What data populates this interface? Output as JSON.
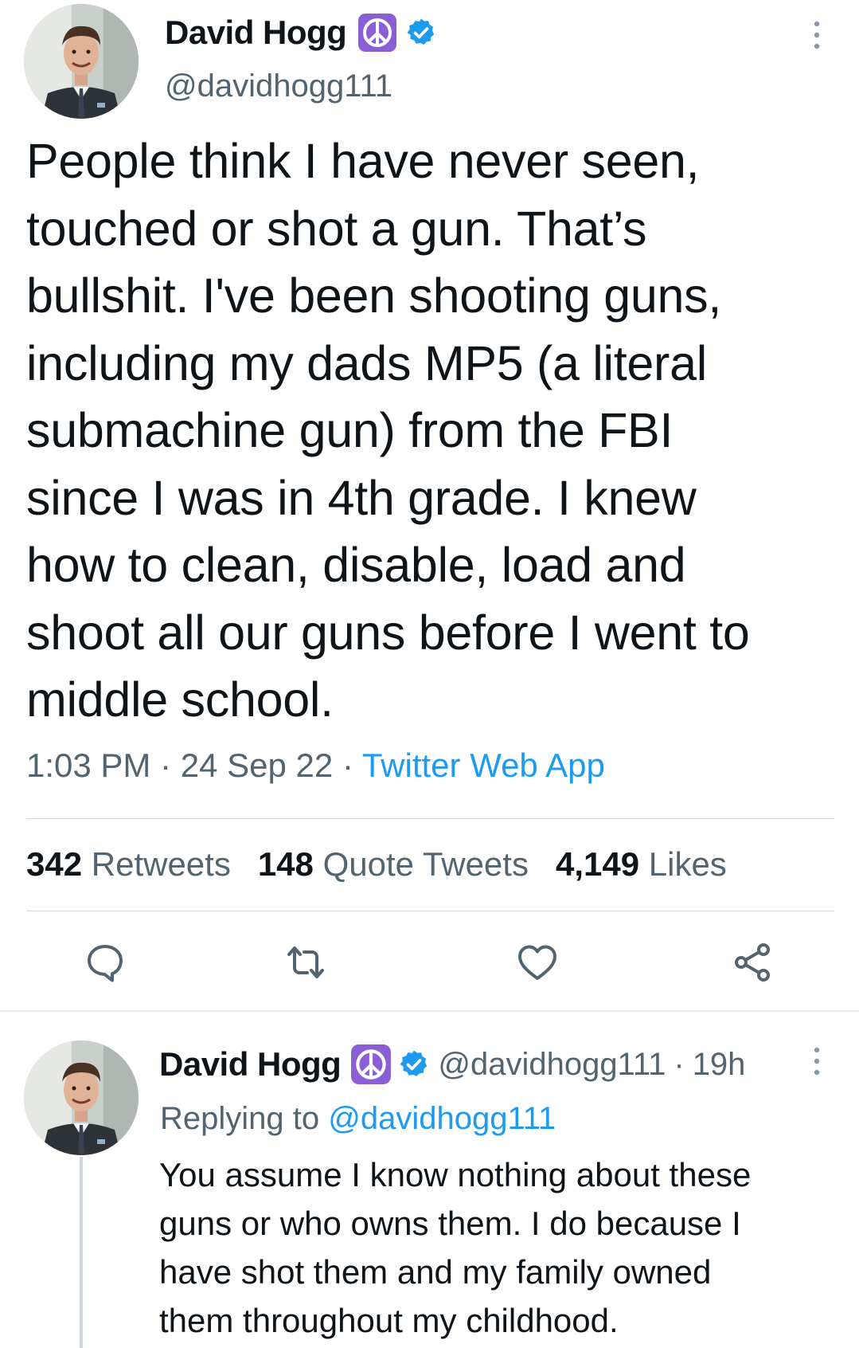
{
  "tweet": {
    "author_name": "David Hogg",
    "handle": "@davidhogg111",
    "text": "People think I have never seen,\ntouched or shot a gun. That’s\nbullshit. I've been shooting guns,\nincluding my dads MP5 (a literal\nsubmachine gun) from the FBI\nsince I was in 4th grade. I knew\nhow to clean, disable, load and\nshoot all our guns before I went to\nmiddle school.",
    "time": "1:03 PM",
    "date": "24 Sep 22",
    "source": "Twitter Web App",
    "stats": {
      "retweets_count": "342",
      "retweets_label": "Retweets",
      "quotes_count": "148",
      "quotes_label": "Quote Tweets",
      "likes_count": "4,149",
      "likes_label": "Likes"
    }
  },
  "reply": {
    "author_name": "David Hogg",
    "handle": "@davidhogg111",
    "time_ago": "19h",
    "replying_label": "Replying to",
    "replying_to": "@davidhogg111",
    "text": "You assume I know nothing about these\nguns or who owns them. I do because I\nhave shot them and my family owned\nthem throughout my childhood."
  },
  "icons": {
    "peace": "peace-sign-emoji-icon",
    "verified": "verified-badge-icon",
    "more": "more-options-icon",
    "reply": "reply-icon",
    "retweet": "retweet-icon",
    "like": "heart-icon",
    "share": "share-icon"
  },
  "colors": {
    "link": "#1d9bf0",
    "secondary_text": "#536471",
    "peace_bg": "#8a5fd6",
    "verified": "#1d9bf0"
  }
}
